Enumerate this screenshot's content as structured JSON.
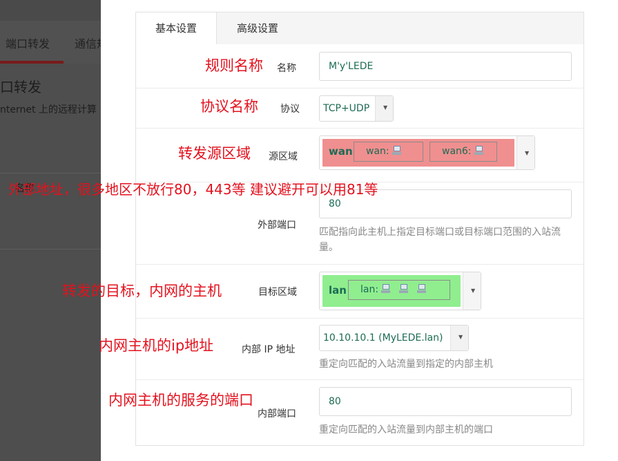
{
  "background_page": {
    "tabs": [
      "端口转发",
      "通信规"
    ],
    "heading": "口转发",
    "description": "nternet 上的远程计算",
    "row_label": "名称"
  },
  "tabs": [
    "基本设置",
    "高级设置"
  ],
  "form": {
    "name": {
      "label": "名称",
      "value": "M'y'LEDE"
    },
    "protocol": {
      "label": "协议",
      "value": "TCP+UDP"
    },
    "source_zone": {
      "label": "源区域",
      "zone": "wan",
      "networks": [
        "wan:",
        "wan6:"
      ],
      "color": "#f08f8f"
    },
    "external_port": {
      "label": "外部端口",
      "value": "80",
      "help": "匹配指向此主机上指定目标端口或目标端口范围的入站流量。"
    },
    "dest_zone": {
      "label": "目标区域",
      "zone": "lan",
      "networks": [
        "lan:"
      ],
      "color": "#90ee8f"
    },
    "internal_ip": {
      "label": "内部 IP 地址",
      "value": "10.10.10.1 (MyLEDE.lan)",
      "help": "重定向匹配的入站流量到指定的内部主机"
    },
    "internal_port": {
      "label": "内部端口",
      "value": "80",
      "help": "重定向匹配的入站流量到内部主机的端口"
    }
  },
  "annotations": {
    "rule_name": "规则名称",
    "protocol_name": "协议名称",
    "source_zone": "转发源区域",
    "external_addr": "外部地址，很多地区不放行80，443等 建议避开可以用81等",
    "target": "转发的目标，内网的主机",
    "ip": "内网主机的ip地址",
    "service_port": "内网主机的服务的端口"
  },
  "colors": {
    "annotation": "#e3121e",
    "value_text": "#1d6b55"
  }
}
